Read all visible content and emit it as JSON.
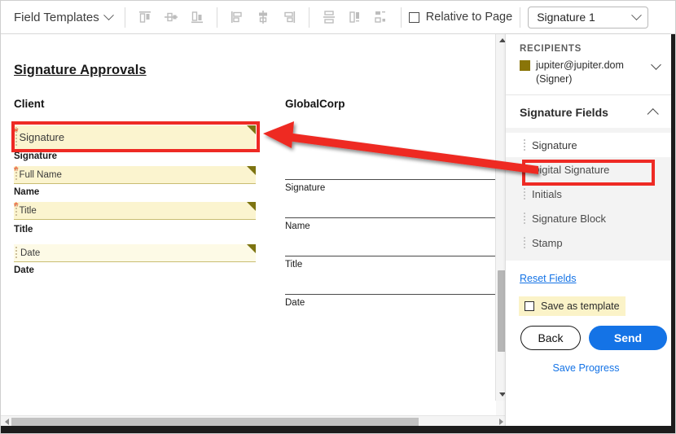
{
  "toolbar": {
    "field_templates_label": "Field Templates",
    "align_icons": [
      {
        "name": "align-top-icon"
      },
      {
        "name": "align-middle-horizontal-icon"
      },
      {
        "name": "align-bottom-icon"
      },
      {
        "name": "align-left-icon"
      },
      {
        "name": "align-center-vertical-icon"
      },
      {
        "name": "align-right-icon"
      }
    ],
    "distribute_icons": [
      {
        "name": "distribute-vertical-icon"
      },
      {
        "name": "match-width-icon"
      },
      {
        "name": "match-size-icon"
      }
    ],
    "relative_to_page_label": "Relative to Page",
    "relative_to_page_checked": false,
    "field_select_value": "Signature 1"
  },
  "document": {
    "title": "Signature Approvals",
    "columns": [
      {
        "heading": "Client"
      },
      {
        "heading": "GlobalCorp"
      }
    ],
    "client_fields": [
      {
        "placeholder": "Signature",
        "label": "Signature",
        "required": true,
        "selected": true
      },
      {
        "placeholder": "Full Name",
        "label": "Name",
        "required": true,
        "selected": false
      },
      {
        "placeholder": "Title",
        "label": "Title",
        "required": true,
        "selected": false
      },
      {
        "placeholder": "Date",
        "label": "Date",
        "required": false,
        "selected": false
      }
    ],
    "globalcorp_lines": [
      {
        "label": "Signature"
      },
      {
        "label": "Name"
      },
      {
        "label": "Title"
      },
      {
        "label": "Date"
      }
    ]
  },
  "sidebar": {
    "recipients": {
      "section_title": "RECIPIENTS",
      "swatch_color": "#8a7508",
      "email": "jupiter@jupiter.dom",
      "role": "(Signer)"
    },
    "signature_fields": {
      "section_title": "Signature Fields",
      "expanded": true,
      "items": [
        {
          "label": "Signature",
          "selected": true
        },
        {
          "label": "Digital Signature",
          "selected": false
        },
        {
          "label": "Initials",
          "selected": false
        },
        {
          "label": "Signature Block",
          "selected": false
        },
        {
          "label": "Stamp",
          "selected": false
        }
      ]
    },
    "reset_fields_label": "Reset Fields",
    "save_as_template_label": "Save as template",
    "save_as_template_checked": false,
    "back_label": "Back",
    "send_label": "Send",
    "save_progress_label": "Save Progress"
  },
  "annotation": {
    "highlight_color": "#ee2a24",
    "arrow_from": "sidebar signature field item",
    "arrow_to": "document signature field"
  },
  "colors": {
    "accent_blue": "#1473e6",
    "field_fill": "#fbf4cf",
    "field_corner": "#7d7411",
    "required_star": "#e8502a"
  }
}
